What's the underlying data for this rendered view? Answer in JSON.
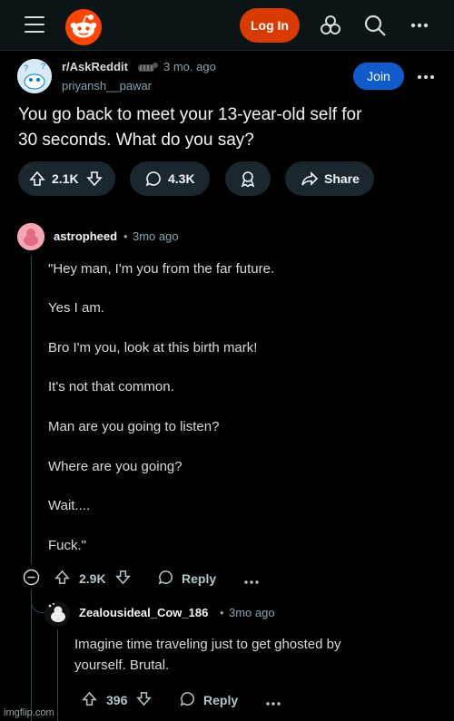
{
  "header": {
    "login_label": "Log In"
  },
  "post": {
    "subreddit": "r/AskReddit",
    "age": "3 mo. ago",
    "author": "priyansh__pawar",
    "join_label": "Join",
    "title_line1": "You go back to meet your 13-year-old self for",
    "title_line2": "30 seconds. What do you say?",
    "votes": "2.1K",
    "comments": "4.3K",
    "share_label": "Share"
  },
  "comment1": {
    "author": "astropheed",
    "separator": "•",
    "age": "3mo ago",
    "lines": [
      "\"Hey man, I'm you from the far future.",
      "Yes I am.",
      "Bro I'm you, look at this birth mark!",
      "It's not that common.",
      "Man are you going to listen?",
      "Where are you going?",
      "Wait....",
      "Fuck.\""
    ],
    "votes": "2.9K",
    "reply_label": "Reply"
  },
  "comment2": {
    "author": "Zealousideal_Cow_186",
    "separator": "•",
    "age": "3mo ago",
    "lines": [
      "Imagine time traveling just to get ghosted by",
      "yourself. Brutal."
    ],
    "votes": "396",
    "reply_label": "Reply"
  },
  "watermark": "imgflip.com",
  "colors": {
    "background": "#000000",
    "topbar": "#0b1416",
    "brand": "#ff4500",
    "login_button": "#d93a00",
    "join_button": "#115bca",
    "pill": "#1a282d"
  }
}
